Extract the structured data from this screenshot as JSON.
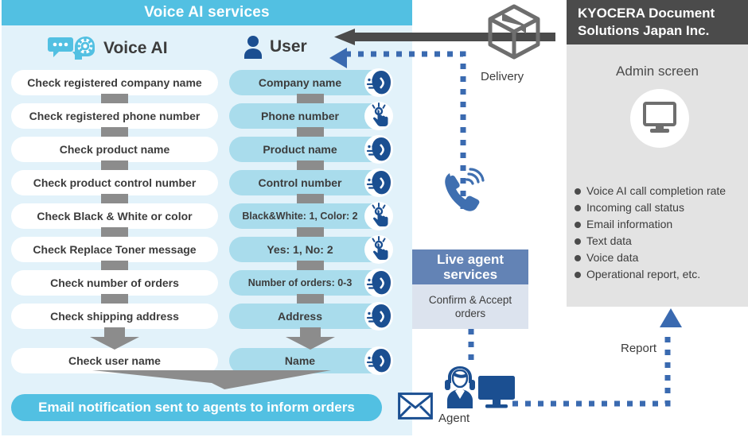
{
  "voice_ai_panel": {
    "header": "Voice AI services",
    "columns": {
      "ai": {
        "label": "Voice AI",
        "icon": "speech-bubble-head-gear-icon"
      },
      "user": {
        "label": "User",
        "icon": "person-icon"
      }
    },
    "rows": [
      {
        "ai": "Check registered company name",
        "user": "Company name",
        "icon": "speaking-head-icon"
      },
      {
        "ai": "Check registered phone number",
        "user": "Phone number",
        "icon": "tap-finger-icon"
      },
      {
        "ai": "Check product name",
        "user": "Product name",
        "icon": "speaking-head-icon"
      },
      {
        "ai": "Check product control number",
        "user": "Control number",
        "icon": "speaking-head-icon"
      },
      {
        "ai": "Check Black & White or color",
        "user": "Black&White: 1, Color: 2",
        "icon": "tap-finger-icon"
      },
      {
        "ai": "Check Replace Toner message",
        "user": "Yes: 1, No: 2",
        "icon": "tap-finger-icon"
      },
      {
        "ai": "Check number of orders",
        "user": "Number of orders: 0-3",
        "icon": "speaking-head-icon"
      },
      {
        "ai": "Check shipping address",
        "user": "Address",
        "icon": "speaking-head-icon"
      },
      {
        "ai": "Check user name",
        "user": "Name",
        "icon": "speaking-head-icon"
      }
    ],
    "email_bar": "Email notification sent to agents to inform orders"
  },
  "middle": {
    "delivery_label": "Delivery",
    "delivery_icon": "package-box-icon",
    "phone_icon": "ringing-phone-icon",
    "live_agent": {
      "title": "Live agent services",
      "body": "Confirm & Accept orders"
    },
    "agent_label": "Agent",
    "agent_icon": "headset-agent-icon",
    "monitor_icon": "monitor-icon",
    "envelope_icon": "envelope-icon",
    "report_label": "Report"
  },
  "kyocera_panel": {
    "company": "KYOCERA Document Solutions Japan Inc.",
    "admin_title": "Admin screen",
    "admin_icon": "monitor-icon",
    "items": [
      "Voice AI call completion rate",
      "Incoming call status",
      "Email information",
      "Text data",
      "Voice data",
      "Operational report, etc."
    ]
  },
  "colors": {
    "cyan": "#52c0e2",
    "panel_bg": "#e2f2fa",
    "user_pill": "#a9dcec",
    "connector_gray": "#8c8c8c",
    "dark_gray": "#4b4b4b",
    "deep_blue": "#1b4f91",
    "dot_blue": "#3a6ab0",
    "slate": "#6383b5",
    "slate_light": "#dce3ee",
    "kyo_bg": "#e3e3e3"
  }
}
